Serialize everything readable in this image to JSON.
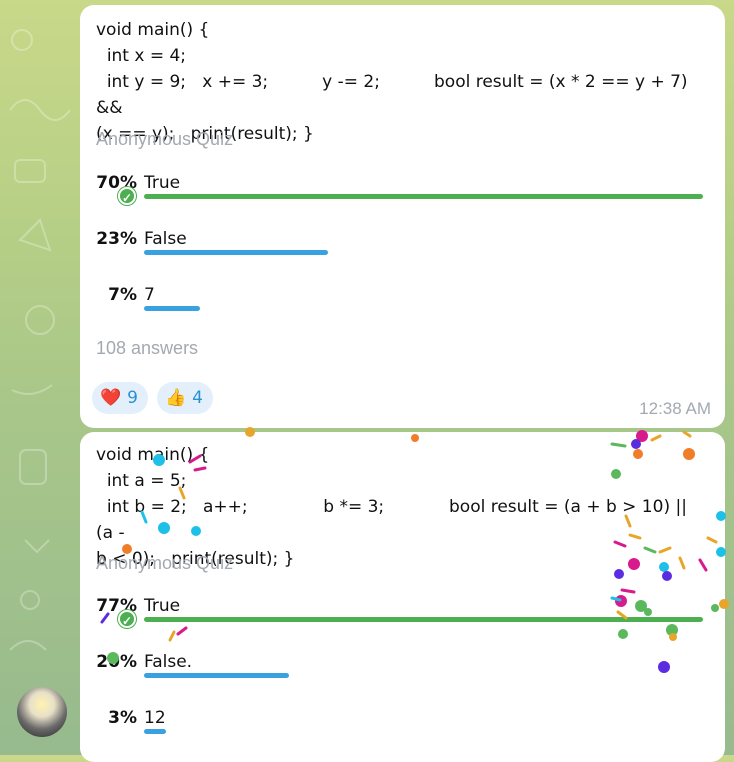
{
  "messages": [
    {
      "question": "void main() {\n  int x = 4;\n  int y = 9;   x += 3;          y -= 2;          bool result = (x * 2 == y + 7) &&\n(x == y);   print(result); }",
      "quiz_type": "Anonymous Quiz",
      "options": [
        {
          "percent": "70%",
          "text": "True",
          "fraction": 0.7,
          "correct": true
        },
        {
          "percent": "23%",
          "text": "False",
          "fraction": 0.23,
          "correct": false
        },
        {
          "percent": "7%",
          "text": "7",
          "fraction": 0.07,
          "correct": false
        }
      ],
      "answers": "108 answers",
      "reactions": [
        {
          "emoji": "heart-icon",
          "glyph": "❤️",
          "count": "9"
        },
        {
          "emoji": "thumbs-up-icon",
          "glyph": "👍",
          "count": "4"
        }
      ],
      "time": "12:38 AM"
    },
    {
      "question": "void main() {\n  int a = 5;\n  int b = 2;   a++;              b *= 3;            bool result = (a + b > 10) || (a -\nb < 0);   print(result); }",
      "quiz_type": "Anonymous Quiz",
      "options": [
        {
          "percent": "77%",
          "text": "True",
          "fraction": 0.77,
          "correct": true
        },
        {
          "percent": "20%",
          "text": "False.",
          "fraction": 0.2,
          "correct": false
        },
        {
          "percent": "3%",
          "text": "12",
          "fraction": 0.03,
          "correct": false
        }
      ]
    }
  ],
  "colors": {
    "correct": "#4caf50",
    "plain": "#3aa1e0",
    "muted": "#a3a9b0",
    "reaction_bg": "#e3f0fb"
  }
}
